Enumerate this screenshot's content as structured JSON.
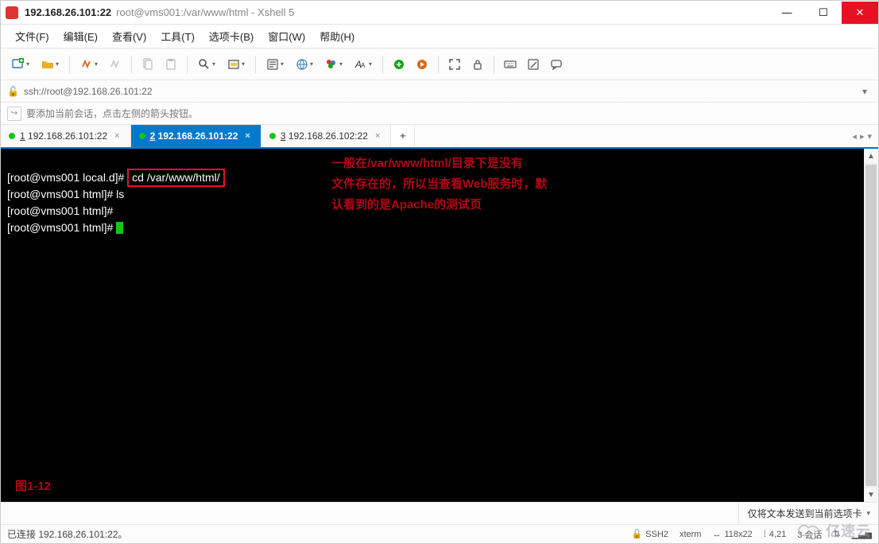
{
  "title": {
    "host": "192.168.26.101:22",
    "rest": "root@vms001:/var/www/html - Xshell 5"
  },
  "menu": {
    "file": "文件(F)",
    "edit": "编辑(E)",
    "view": "查看(V)",
    "tools": "工具(T)",
    "tabs": "选项卡(B)",
    "window": "窗口(W)",
    "help": "帮助(H)"
  },
  "toolbar_icons": {
    "new_session": "new-session-icon",
    "open": "open-icon",
    "save": "disconnect-icon",
    "reconnect": "reconnect-icon",
    "copy": "copy-icon",
    "paste": "paste-icon",
    "find": "find-icon",
    "clear": "clear-icon",
    "props": "props-icon",
    "lang": "globe-icon",
    "coloring": "coloring-icon",
    "font": "font-icon",
    "ftp": "xftp-icon",
    "start": "xstartcmd-icon",
    "fullscreen": "fullscreen-icon",
    "lock": "lock-icon",
    "kbd": "keyboard-icon",
    "compose": "compose-icon",
    "msg": "message-icon"
  },
  "address": {
    "lock": "🔓",
    "value": "ssh://root@192.168.26.101:22"
  },
  "hint": "要添加当前会话，点击左侧的箭头按钮。",
  "tabs_bar": {
    "items": [
      {
        "index": "1",
        "label": "192.168.26.101:22",
        "active": false
      },
      {
        "index": "2",
        "label": "192.168.26.101:22",
        "active": true
      },
      {
        "index": "3",
        "label": "192.168.26.102:22",
        "active": false
      }
    ]
  },
  "terminal": {
    "line1_prompt": "[root@vms001 local.d]# ",
    "line1_cmd": "cd /var/www/html/",
    "line2": "[root@vms001 html]# ls",
    "line3": "[root@vms001 html]#",
    "line4": "[root@vms001 html]# ",
    "anno1": "一般在/var/www/html/目录下是没有",
    "anno2": "文件存在的，所以当查看Web服务时，默",
    "anno3": "认看到的是Apache的测试页",
    "figlabel": "图1-12"
  },
  "sendbar": {
    "placeholder": "",
    "select": "仅将文本发送到当前选项卡"
  },
  "status": {
    "left": "已连接 192.168.26.101:22。",
    "ssh": "SSH2",
    "term": "xterm",
    "size": "118x22",
    "pos": "4,21",
    "sessions": "3 会话"
  },
  "watermark": "亿速云"
}
